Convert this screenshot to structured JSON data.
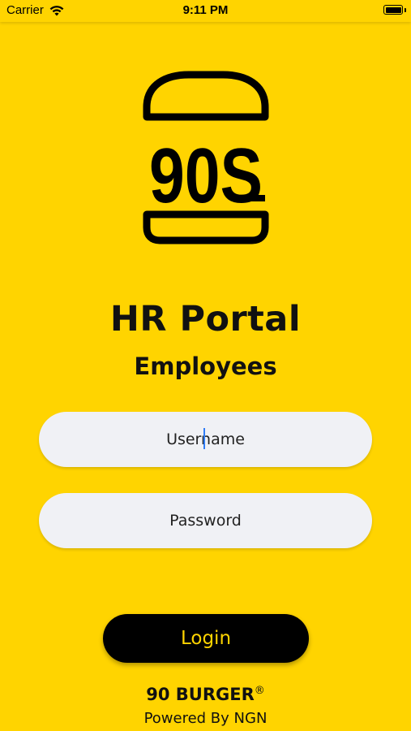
{
  "status_bar": {
    "carrier": "Carrier",
    "time": "9:11 PM",
    "wifi_icon": "wifi-icon",
    "battery_icon": "battery-icon"
  },
  "logo": {
    "text": "90S",
    "icon": "burger-logo-icon"
  },
  "header": {
    "title": "HR Portal",
    "subtitle": "Employees"
  },
  "form": {
    "username_placeholder": "Username",
    "username_value": "",
    "password_placeholder": "Password",
    "password_value": "",
    "login_label": "Login"
  },
  "footer": {
    "brand": "90 BURGER",
    "registered": "®",
    "powered_by": "Powered By NGN"
  },
  "colors": {
    "background": "#FFD400",
    "field": "#F0F1F5",
    "button": "#000000",
    "button_text": "#FFD400",
    "caret": "#2F7CF6"
  }
}
